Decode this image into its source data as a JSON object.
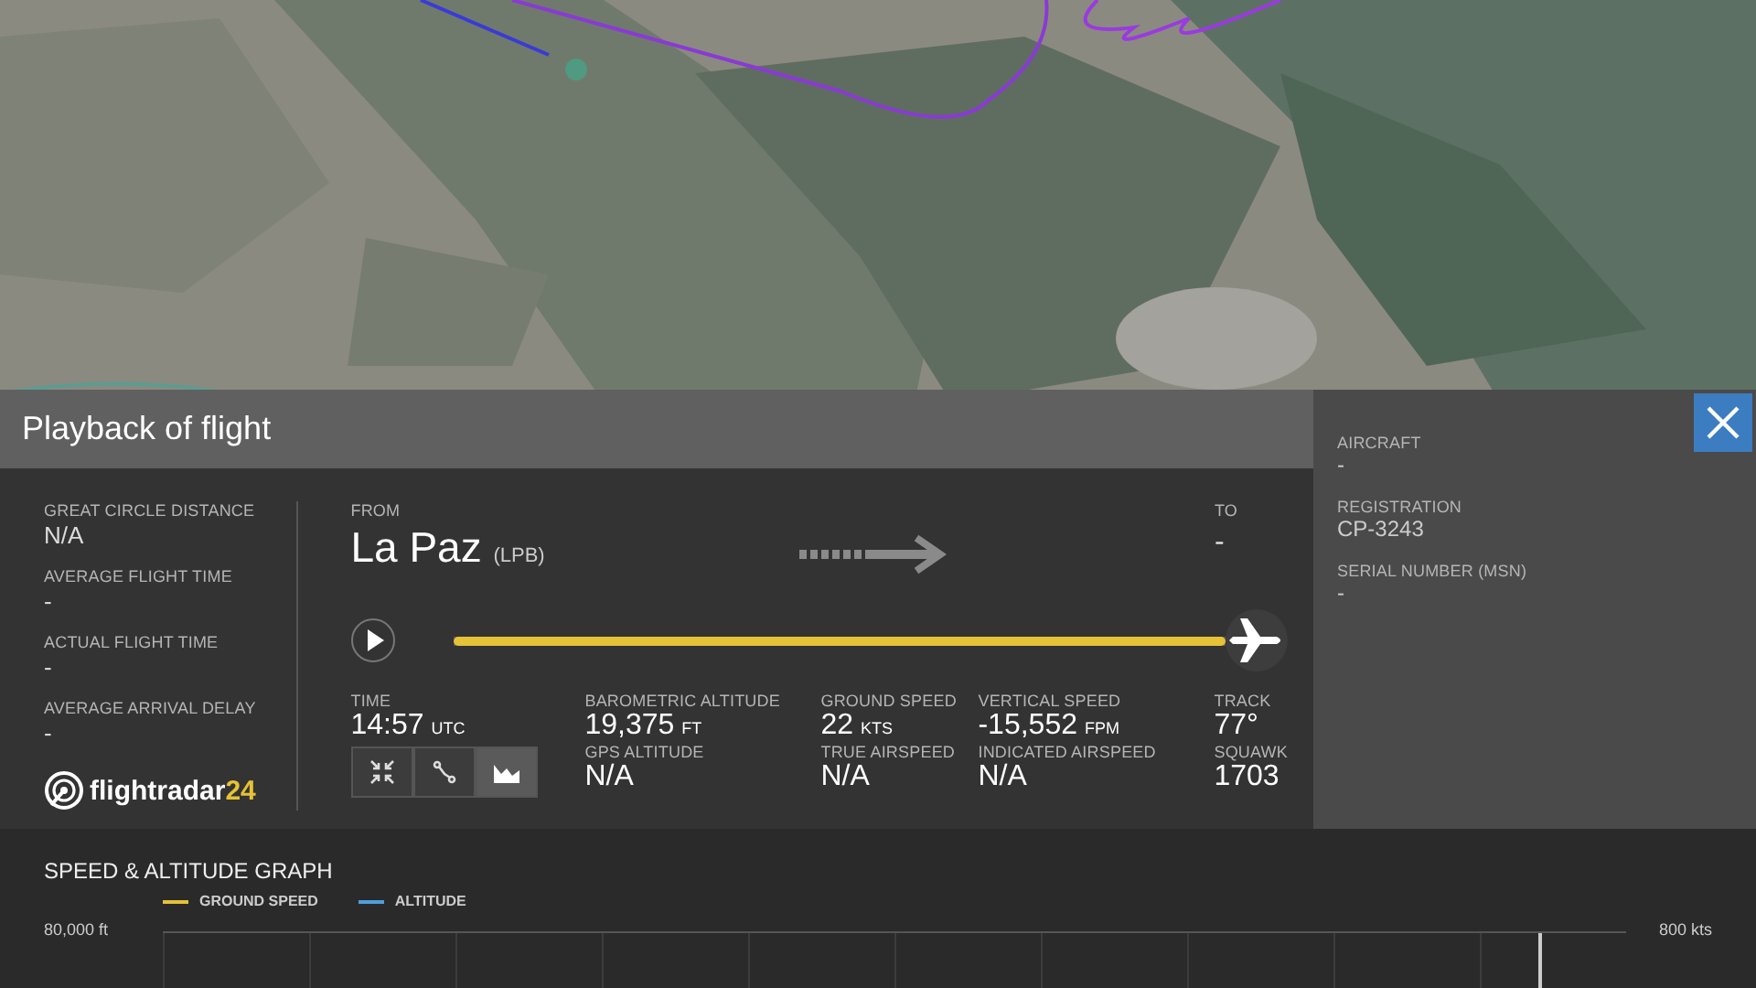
{
  "panel_title": "Playback of flight",
  "stats": [
    {
      "label": "GREAT CIRCLE DISTANCE",
      "value": "N/A"
    },
    {
      "label": "AVERAGE FLIGHT TIME",
      "value": "-"
    },
    {
      "label": "ACTUAL FLIGHT TIME",
      "value": "-"
    },
    {
      "label": "AVERAGE ARRIVAL DELAY",
      "value": "-"
    }
  ],
  "logo": {
    "name": "flightradar",
    "suffix": "24"
  },
  "route": {
    "from_label": "FROM",
    "from_city": "La Paz",
    "from_code": "(LPB)",
    "to_label": "TO",
    "to_value": "-"
  },
  "playback": {
    "level": 1
  },
  "readouts_top": [
    {
      "label": "TIME",
      "value": "14:57",
      "unit": "UTC"
    },
    {
      "label": "BAROMETRIC ALTITUDE",
      "value": "19,375",
      "unit": "FT"
    },
    {
      "label": "GROUND SPEED",
      "value": "22",
      "unit": "KTS"
    },
    {
      "label": "VERTICAL SPEED",
      "value": "-15,552",
      "unit": "FPM"
    },
    {
      "label": "TRACK",
      "value": "77°"
    }
  ],
  "readouts_bottom": [
    {
      "label": "GPS ALTITUDE",
      "value": "N/A"
    },
    {
      "label": "TRUE AIRSPEED",
      "value": "N/A"
    },
    {
      "label": "INDICATED AIRSPEED",
      "value": "N/A"
    },
    {
      "label": "SQUAWK",
      "value": "1703"
    }
  ],
  "view_buttons": [
    {
      "kind": "collapse",
      "selected": false
    },
    {
      "kind": "route",
      "selected": false
    },
    {
      "kind": "graph",
      "selected": true
    }
  ],
  "aircraft": [
    {
      "label": "AIRCRAFT",
      "value": "-"
    },
    {
      "label": "REGISTRATION",
      "value": "CP-3243"
    },
    {
      "label": "SERIAL NUMBER (MSN)",
      "value": "-"
    }
  ],
  "graph": {
    "title": "SPEED & ALTITUDE GRAPH",
    "legend": [
      {
        "name": "GROUND SPEED",
        "color": "#e5c237"
      },
      {
        "name": "ALTITUDE",
        "color": "#4d9fdc"
      }
    ],
    "left_axis": "80,000 ft",
    "right_axis": "800 kts"
  }
}
